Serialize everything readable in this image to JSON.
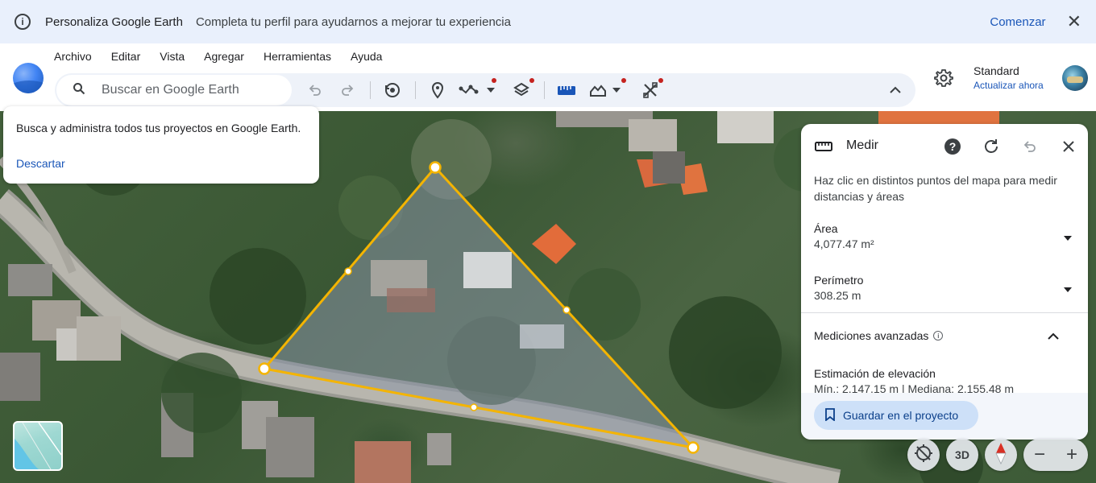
{
  "banner": {
    "title": "Personaliza Google Earth",
    "text": "Completa tu perfil para ayudarnos a mejorar tu experiencia",
    "cta": "Comenzar"
  },
  "menu": [
    "Archivo",
    "Editar",
    "Vista",
    "Agregar",
    "Herramientas",
    "Ayuda"
  ],
  "search": {
    "placeholder": "Buscar en Google Earth"
  },
  "account": {
    "plan": "Standard",
    "upgrade": "Actualizar ahora"
  },
  "tooltip": {
    "text": "Busca y administra todos tus proyectos en Google Earth.",
    "dismiss": "Descartar"
  },
  "measure": {
    "title": "Medir",
    "description": "Haz clic en distintos puntos del mapa para medir distancias y áreas",
    "area_label": "Área",
    "area_value": "4,077.47 m²",
    "perimeter_label": "Perímetro",
    "perimeter_value": "308.25 m",
    "advanced_label": "Mediciones avanzadas",
    "elevation_label": "Estimación de elevación",
    "elevation_value": "Mín.: 2.147.15 m | Mediana: 2.155.48 m |",
    "save_label": "Guardar en el proyecto"
  },
  "map_controls": {
    "view_3d": "3D"
  },
  "colors": {
    "accent": "#1a56b8",
    "banner_bg": "#e9f0fc",
    "measure_line": "#f4b400",
    "notification_dot": "#c5221f"
  }
}
